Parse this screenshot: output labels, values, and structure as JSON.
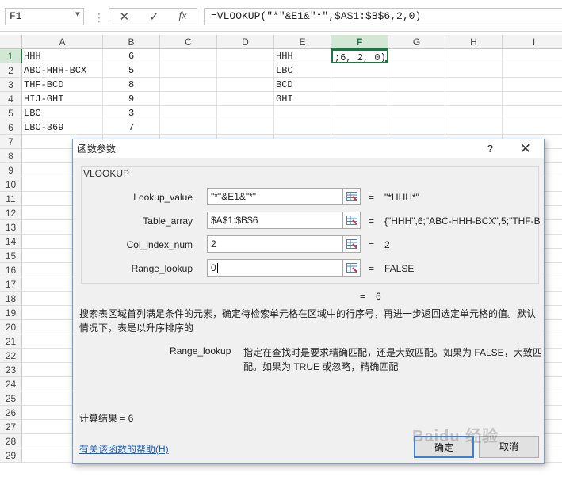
{
  "formula_bar": {
    "name_box": "F1",
    "cancel_icon": "✕",
    "enter_icon": "✓",
    "fx_icon": "fx",
    "formula": "=VLOOKUP(\"*\"&E1&\"*\",$A$1:$B$6,2,0)"
  },
  "sheet": {
    "columns": [
      "A",
      "B",
      "C",
      "D",
      "E",
      "F",
      "G",
      "H",
      "I"
    ],
    "selected_column": "F",
    "rows": [
      "1",
      "2",
      "3",
      "4",
      "5",
      "6",
      "7",
      "8",
      "9",
      "10",
      "11",
      "12",
      "13",
      "14",
      "15",
      "16",
      "17",
      "18",
      "19",
      "20",
      "21",
      "22",
      "23",
      "24",
      "25",
      "26",
      "27",
      "28",
      "29"
    ],
    "selected_row": "1",
    "col_a": [
      "HHH",
      "ABC-HHH-BCX",
      "THF-BCD",
      "HIJ-GHI",
      "LBC",
      "LBC-369"
    ],
    "col_b": [
      "6",
      "5",
      "8",
      "9",
      "3",
      "7"
    ],
    "col_e": [
      "HHH",
      "LBC",
      "BCD",
      "GHI"
    ],
    "active_cell_text": ";6, 2, 0)"
  },
  "dialog": {
    "title": "函数参数",
    "help_glyph": "?",
    "close_glyph": "✕",
    "function_name": "VLOOKUP",
    "args": [
      {
        "label": "Lookup_value",
        "value": "\"*\"&E1&\"*\"",
        "result": "\"*HHH*\""
      },
      {
        "label": "Table_array",
        "value": "$A$1:$B$6",
        "result": "{\"HHH\",6;\"ABC-HHH-BCX\",5;\"THF-B"
      },
      {
        "label": "Col_index_num",
        "value": "2",
        "result": "2"
      },
      {
        "label": "Range_lookup",
        "value": "0",
        "result": "FALSE"
      }
    ],
    "equals": "=",
    "overall_result": "6",
    "description": "搜索表区域首列满足条件的元素，确定待检索单元格在区域中的行序号，再进一步返回选定单元格的值。默认情况下，表是以升序排序的",
    "param_name": "Range_lookup",
    "param_description": "指定在查找时是要求精确匹配，还是大致匹配。如果为 FALSE，大致匹配。如果为 TRUE 或忽略，精确匹配",
    "calc_result": "计算结果 =   6",
    "help_link": "有关该函数的帮助(H)",
    "ok_label": "确定",
    "cancel_label": "取消"
  },
  "watermark": "Baidu 经验"
}
